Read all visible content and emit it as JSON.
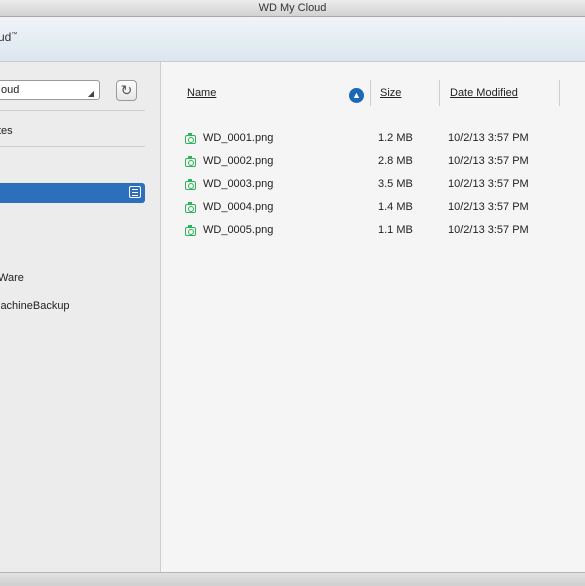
{
  "window": {
    "title": "WD My Cloud"
  },
  "app": {
    "brand": "ud",
    "brand_mark": "™"
  },
  "sidebar": {
    "device": "oud",
    "refresh_icon": "refresh-icon",
    "items": [
      "tes",
      "Ware",
      "lachineBackup"
    ]
  },
  "file_list": {
    "headers": {
      "name": "Name",
      "size": "Size",
      "date": "Date Modified"
    },
    "sort_icon": "sort-ascending-icon",
    "rows": [
      {
        "name": "WD_0001.png",
        "size": "1.2 MB",
        "date": "10/2/13 3:57 PM"
      },
      {
        "name": "WD_0002.png",
        "size": "2.8 MB",
        "date": "10/2/13 3:57 PM"
      },
      {
        "name": "WD_0003.png",
        "size": "3.5 MB",
        "date": "10/2/13 3:57 PM"
      },
      {
        "name": "WD_0004.png",
        "size": "1.4 MB",
        "date": "10/2/13 3:57 PM"
      },
      {
        "name": "WD_0005.png",
        "size": "1.1 MB",
        "date": "10/2/13 3:57 PM"
      }
    ]
  },
  "colors": {
    "accent": "#2c6fbd",
    "file_icon": "#2db35a"
  }
}
